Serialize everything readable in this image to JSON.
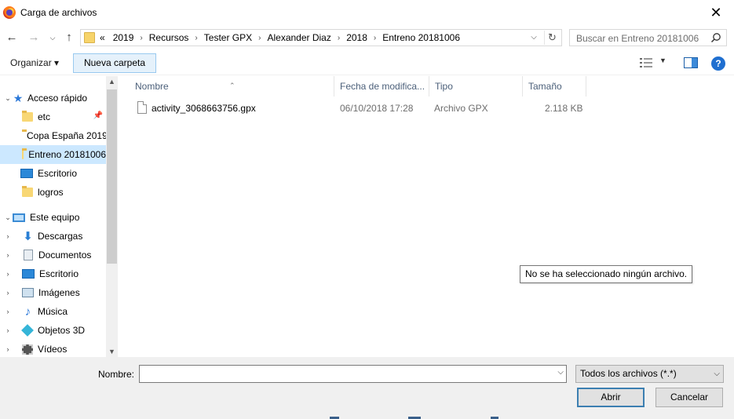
{
  "window": {
    "title": "Carga de archivos",
    "close_icon": "close-icon"
  },
  "address": {
    "overflow": "«",
    "crumbs": [
      "2019",
      "Recursos",
      "Tester GPX",
      "Alexander Diaz",
      "2018",
      "Entreno 20181006"
    ]
  },
  "search": {
    "placeholder": "Buscar en Entreno 20181006"
  },
  "toolbar": {
    "organize_label": "Organizar ▾",
    "new_folder_label": "Nueva carpeta",
    "help_label": "?"
  },
  "nav": {
    "quick_access": "Acceso rápido",
    "quick_items": [
      "etc",
      "Copa España 2019",
      "Entreno 20181006",
      "Escritorio",
      "logros"
    ],
    "this_pc": "Este equipo",
    "pc_items": [
      "Descargas",
      "Documentos",
      "Escritorio",
      "Imágenes",
      "Música",
      "Objetos 3D",
      "Vídeos"
    ]
  },
  "columns": {
    "name": "Nombre",
    "date": "Fecha de modifica...",
    "type": "Tipo",
    "size": "Tamaño"
  },
  "files": [
    {
      "name": "activity_3068663756.gpx",
      "date": "06/10/2018 17:28",
      "type": "Archivo GPX",
      "size": "2.118 KB"
    }
  ],
  "tooltip": "No se ha seleccionado ningún archivo.",
  "bottom": {
    "name_label": "Nombre:",
    "name_value": "",
    "filter_value": "Todos los archivos (*.*)",
    "open_label": "Abrir",
    "cancel_label": "Cancelar"
  },
  "colors": {
    "selection": "#cce8ff",
    "accent": "#1f6fd0",
    "button_face": "#e1e1e1"
  }
}
